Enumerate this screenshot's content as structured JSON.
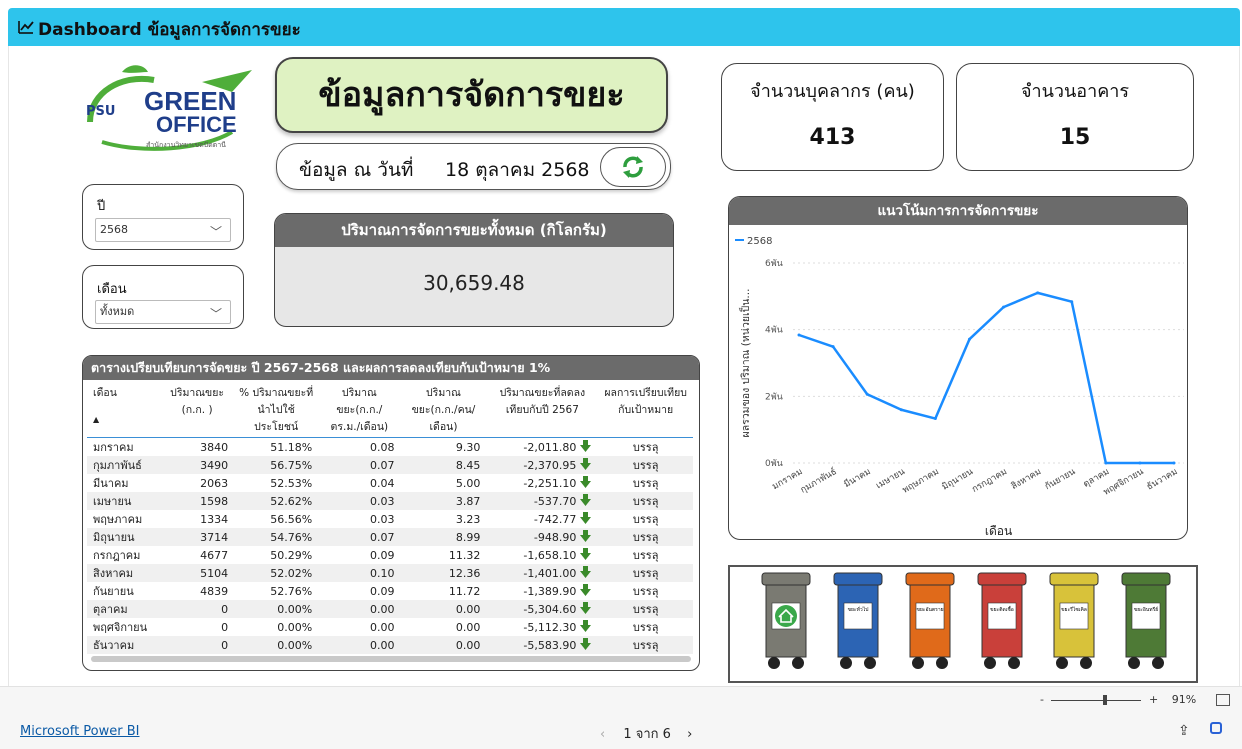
{
  "header": {
    "title": "Dashboard ข้อมูลการจัดการขยะ"
  },
  "logo": {
    "psu": "PSU",
    "green": "GREEN",
    "office": "OFFICE",
    "subtitle": "สำนักงานวิทยาเขตปัตตานี"
  },
  "main_title": "ข้อมูลการจัดการขยะ",
  "date_box": {
    "label": "ข้อมูล ณ วันที่",
    "value": "18 ตุลาคม 2568"
  },
  "cards": {
    "staff": {
      "label": "จำนวนบุคลากร (คน)",
      "value": "413"
    },
    "buildings": {
      "label": "จำนวนอาคาร",
      "value": "15"
    }
  },
  "slicers": {
    "year": {
      "label": "ปี",
      "value": "2568"
    },
    "month": {
      "label": "เดือน",
      "value": "ทั้งหมด"
    }
  },
  "total": {
    "title": "ปริมาณการจัดการขยะทั้งหมด (กิโลกรัม)",
    "value": "30,659.48"
  },
  "table": {
    "title": "ตารางเปรียบเทียบการจัดขยะ ปี 2567-2568 และผลการลดลงเทียบกับเป้าหมาย 1%",
    "columns": [
      "เดือน",
      "ปริมาณขยะ (ก.ก. )",
      "% ปริมาณขยะที่นำไปใช้ประโยชน์",
      "ปริมาณขยะ(ก.ก./ตร.ม./เดือน)",
      "ปริมาณขยะ(ก.ก./คน/เดือน)",
      "ปริมาณขยะที่ลดลงเทียบกับปี 2567",
      "ผลการเปรียบเทียบกับเป้าหมาย"
    ],
    "rows": [
      [
        "มกราคม",
        "3840",
        "51.18%",
        "0.08",
        "9.30",
        "-2,011.80",
        "บรรลุ"
      ],
      [
        "กุมภาพันธ์",
        "3490",
        "56.75%",
        "0.07",
        "8.45",
        "-2,370.95",
        "บรรลุ"
      ],
      [
        "มีนาคม",
        "2063",
        "52.53%",
        "0.04",
        "5.00",
        "-2,251.10",
        "บรรลุ"
      ],
      [
        "เมษายน",
        "1598",
        "52.62%",
        "0.03",
        "3.87",
        "-537.70",
        "บรรลุ"
      ],
      [
        "พฤษภาคม",
        "1334",
        "56.56%",
        "0.03",
        "3.23",
        "-742.77",
        "บรรลุ"
      ],
      [
        "มิถุนายน",
        "3714",
        "54.76%",
        "0.07",
        "8.99",
        "-948.90",
        "บรรลุ"
      ],
      [
        "กรกฎาคม",
        "4677",
        "50.29%",
        "0.09",
        "11.32",
        "-1,658.10",
        "บรรลุ"
      ],
      [
        "สิงหาคม",
        "5104",
        "52.02%",
        "0.10",
        "12.36",
        "-1,401.00",
        "บรรลุ"
      ],
      [
        "กันยายน",
        "4839",
        "52.76%",
        "0.09",
        "11.72",
        "-1,389.90",
        "บรรลุ"
      ],
      [
        "ตุลาคม",
        "0",
        "0.00%",
        "0.00",
        "0.00",
        "-5,304.60",
        "บรรลุ"
      ],
      [
        "พฤศจิกายน",
        "0",
        "0.00%",
        "0.00",
        "0.00",
        "-5,112.30",
        "บรรลุ"
      ],
      [
        "ธันวาคม",
        "0",
        "0.00%",
        "0.00",
        "0.00",
        "-5,583.90",
        "บรรลุ"
      ]
    ]
  },
  "chart_data": {
    "type": "line",
    "title": "แนวโน้มการการจัดการขยะ",
    "xlabel": "เดือน",
    "ylabel": "ผลรวมของ ปริมาณ (หน่วยเป็น...",
    "categories": [
      "มกราคม",
      "กุมภาพันธ์",
      "มีนาคม",
      "เมษายน",
      "พฤษภาคม",
      "มิถุนายน",
      "กรกฎาคม",
      "สิงหาคม",
      "กันยายน",
      "ตุลาคม",
      "พฤศจิกายน",
      "ธันวาคม"
    ],
    "series": [
      {
        "name": "2568",
        "values": [
          3840,
          3490,
          2063,
          1598,
          1334,
          3714,
          4677,
          5104,
          4839,
          0,
          0,
          0
        ],
        "color": "#1a8cff"
      }
    ],
    "ylim": [
      0,
      6000
    ],
    "yticks": [
      "0พัน",
      "2พัน",
      "4พัน",
      "6พัน"
    ],
    "grid": true,
    "legend": "top-left"
  },
  "bins": [
    {
      "color": "#7a7a72",
      "label": ""
    },
    {
      "color": "#2c64b4",
      "label": "ขยะทั่วไป"
    },
    {
      "color": "#e06a1a",
      "label": "ขยะอันตราย"
    },
    {
      "color": "#c9403a",
      "label": "ขยะติดเชื้อ"
    },
    {
      "color": "#d8c23a",
      "label": "ขยะรีไซเคิล"
    },
    {
      "color": "#4e7a36",
      "label": "ขยะอินทรีย์"
    }
  ],
  "footer": {
    "brand": "Microsoft Power BI",
    "page": "1 จาก 6",
    "zoom": "91%"
  },
  "colors": {
    "topbar": "#2ec4ec",
    "title_bg": "#dff2c2",
    "header_grey": "#6b6b6b",
    "arrow_green": "#3a8a2a",
    "line_blue": "#1a8cff"
  }
}
